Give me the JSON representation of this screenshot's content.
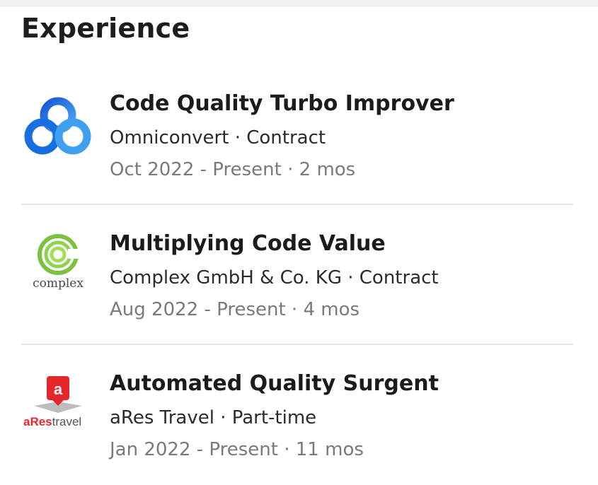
{
  "section": {
    "title": "Experience"
  },
  "experiences": [
    {
      "title": "Code Quality Turbo Improver",
      "company": "Omniconvert · Contract",
      "dates": "Oct 2022 - Present · 2 mos",
      "logo_icon": "omniconvert-logo-icon",
      "logo_color": "#1a73e8"
    },
    {
      "title": "Multiplying Code Value",
      "company": "Complex GmbH & Co. KG · Contract",
      "dates": "Aug 2022 - Present · 4 mos",
      "logo_icon": "complex-logo-icon",
      "logo_text": "complex",
      "logo_color": "#7cc242"
    },
    {
      "title": "Automated Quality Surgent",
      "company": "aRes Travel · Part-time",
      "dates": "Jan 2022 - Present · 11 mos",
      "logo_icon": "ares-travel-logo-icon",
      "logo_text_a": "aRes",
      "logo_text_b": "travel",
      "logo_badge": "a",
      "logo_color": "#e5262b"
    }
  ],
  "colors": {
    "title": "#1b1b1b",
    "secondary": "#2b2b2b",
    "muted": "#7a7a7a",
    "divider": "#e5e5e5"
  }
}
